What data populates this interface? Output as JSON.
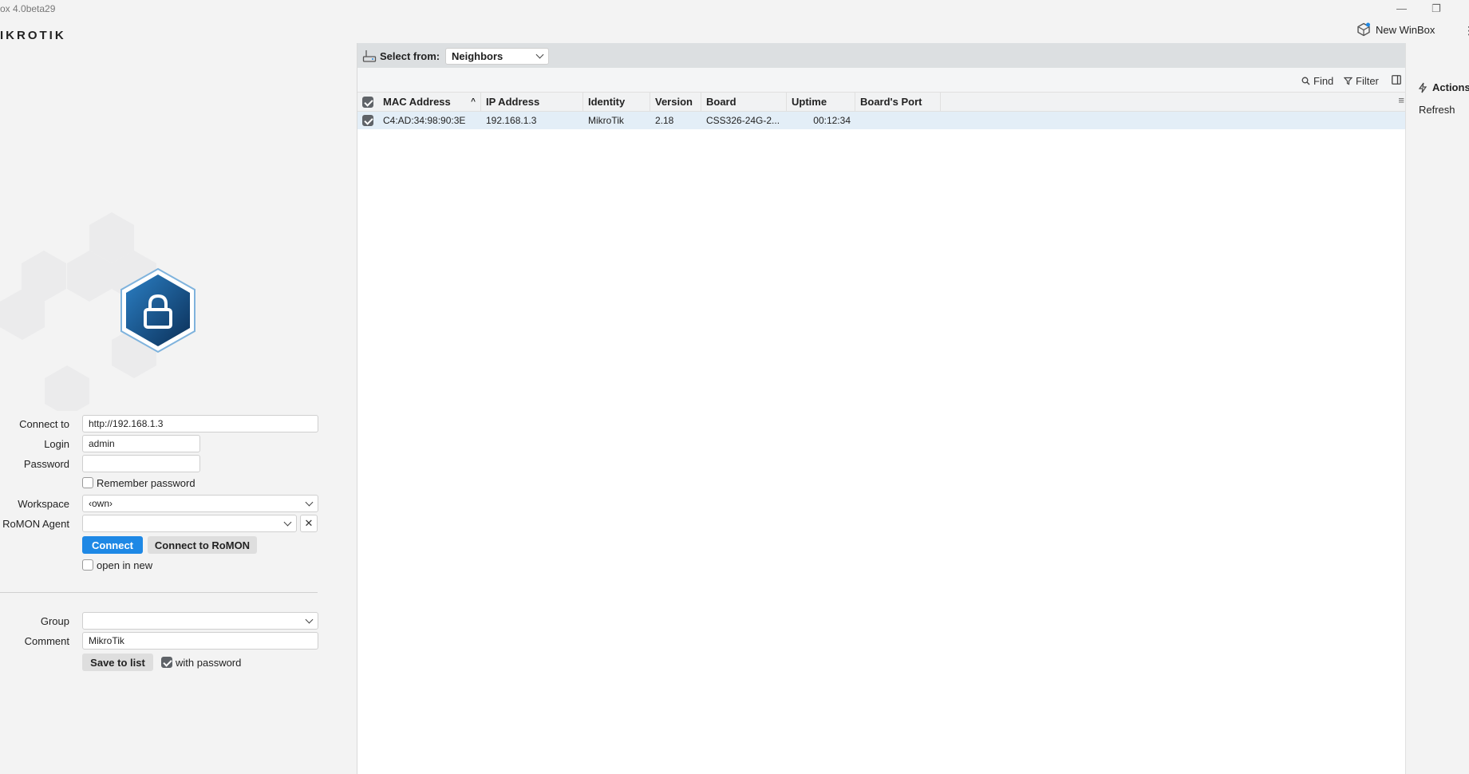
{
  "window": {
    "title": "ox 4.0beta29",
    "minimize_glyph": "—",
    "restore_glyph": "❐"
  },
  "brand": "IKROTIK",
  "header": {
    "new_winbox_label": "New WinBox",
    "new_winbox_icon": "cube-icon",
    "more_glyph": "⋮"
  },
  "login": {
    "connect_to_label": "Connect to",
    "connect_to_value": "http://192.168.1.3",
    "login_label": "Login",
    "login_value": "admin",
    "password_label": "Password",
    "password_value": "",
    "remember_password_label": "Remember password",
    "remember_password_checked": false,
    "workspace_label": "Workspace",
    "workspace_value": "‹own›",
    "romon_agent_label": "RoMON Agent",
    "romon_agent_value": "",
    "clear_glyph": "✕",
    "connect_button": "Connect",
    "connect_romon_button": "Connect to RoMON",
    "open_in_new_label": "open in new",
    "open_in_new_checked": false,
    "group_label": "Group",
    "group_value": "",
    "comment_label": "Comment",
    "comment_value": "MikroTik",
    "save_button": "Save to list",
    "with_password_label": "with password",
    "with_password_checked": true
  },
  "main": {
    "select_from_label": "Select from:",
    "select_from_value": "Neighbors",
    "toolbar": {
      "find_label": "Find",
      "filter_label": "Filter"
    },
    "table": {
      "columns": [
        "MAC Address",
        "IP Address",
        "Identity",
        "Version",
        "Board",
        "Uptime",
        "Board's Port"
      ],
      "rows": [
        {
          "checked": true,
          "cells": [
            "C4:AD:34:98:90:3E",
            "192.168.1.3",
            "MikroTik",
            "2.18",
            "CSS326-24G-2...",
            "00:12:34",
            ""
          ]
        }
      ]
    }
  },
  "actions": {
    "title": "Actions",
    "items": [
      "Refresh"
    ]
  },
  "colors": {
    "accent": "#1e88e5",
    "row_selected": "#e3eef7",
    "lock_dark": "#0f3a66",
    "lock_light": "#2b7fc4"
  }
}
